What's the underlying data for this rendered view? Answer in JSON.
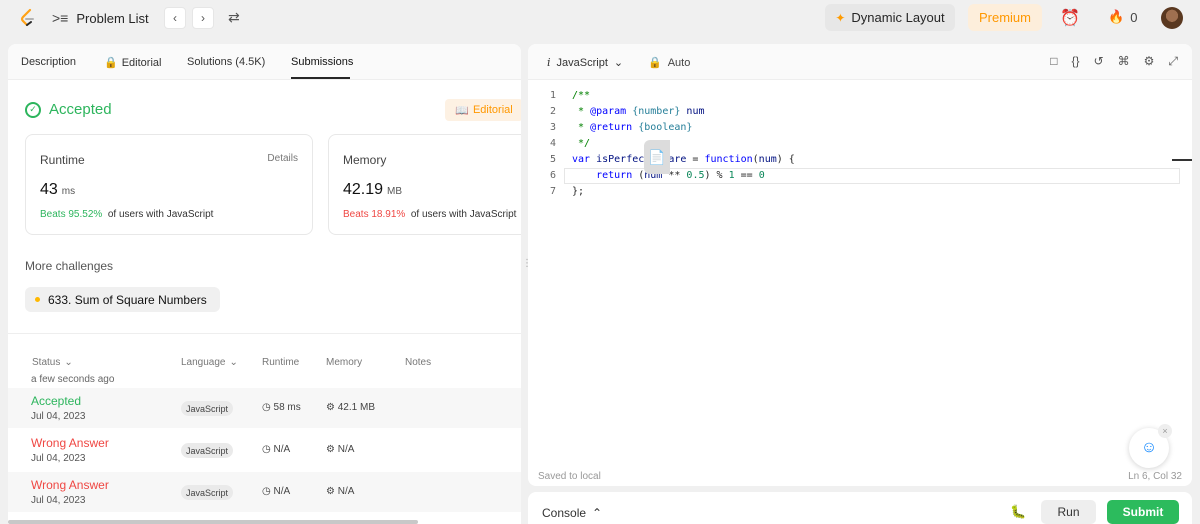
{
  "nav": {
    "problem_list": "Problem List",
    "dynamic_layout": "Dynamic Layout",
    "premium": "Premium",
    "fire_count": "0"
  },
  "tabs": [
    {
      "label": "Description"
    },
    {
      "label": "Editorial"
    },
    {
      "label": "Solutions (4.5K)"
    },
    {
      "label": "Submissions"
    }
  ],
  "result": {
    "status": "Accepted",
    "editorial_btn": "Editorial",
    "runtime": {
      "title": "Runtime",
      "details": "Details",
      "value": "43",
      "unit": "ms",
      "beats_pct": "Beats 95.52%",
      "beats_text": "of users with JavaScript"
    },
    "memory": {
      "title": "Memory",
      "value": "42.19",
      "unit": "MB",
      "beats_pct": "Beats 18.91%",
      "beats_text": "of users with JavaScript"
    }
  },
  "challenges": {
    "heading": "More challenges",
    "items": [
      {
        "label": "633. Sum of Square Numbers"
      }
    ]
  },
  "submissions": {
    "headers": {
      "status": "Status",
      "language": "Language",
      "runtime": "Runtime",
      "memory": "Memory",
      "notes": "Notes"
    },
    "cutoff_text": "a few seconds ago",
    "rows": [
      {
        "status": "Accepted",
        "date": "Jul 04, 2023",
        "language": "JavaScript",
        "runtime": "58 ms",
        "memory": "42.1 MB"
      },
      {
        "status": "Wrong Answer",
        "date": "Jul 04, 2023",
        "language": "JavaScript",
        "runtime": "N/A",
        "memory": "N/A"
      },
      {
        "status": "Wrong Answer",
        "date": "Jul 04, 2023",
        "language": "JavaScript",
        "runtime": "N/A",
        "memory": "N/A"
      }
    ]
  },
  "editor": {
    "language": "JavaScript",
    "lang_prefix": "i",
    "mode": "Auto",
    "saved": "Saved to local",
    "cursor": "Ln 6, Col 32",
    "lines": [
      "1",
      "2",
      "3",
      "4",
      "5",
      "6",
      "7"
    ]
  },
  "console": {
    "label": "Console",
    "run": "Run",
    "submit": "Submit"
  },
  "colors": {
    "accent": "#ffa116",
    "success": "#2db55d",
    "error": "#ef4743",
    "submit": "#2cbb5d"
  }
}
